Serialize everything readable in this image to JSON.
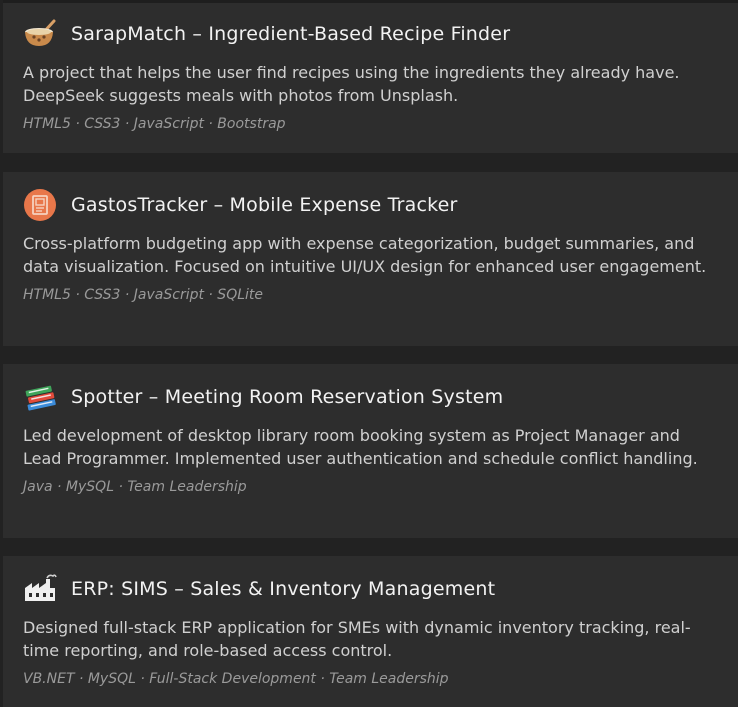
{
  "projects": [
    {
      "icon": "mixing-bowl-icon",
      "title": "SarapMatch – Ingredient-Based Recipe Finder",
      "description": "A project that helps the user find recipes using the ingredients they already have. DeepSeek suggests meals with photos from Unsplash.",
      "tags": "HTML5 · CSS3 · JavaScript · Bootstrap"
    },
    {
      "icon": "receipt-app-icon",
      "title": "GastosTracker – Mobile Expense Tracker",
      "description": "Cross-platform budgeting app with expense categorization, budget summaries, and data visualization. Focused on intuitive UI/UX design for enhanced user engagement.",
      "tags": "HTML5 · CSS3 · JavaScript · SQLite"
    },
    {
      "icon": "books-icon",
      "title": "Spotter – Meeting Room Reservation System",
      "description": "Led development of desktop library room booking system as Project Manager and Lead Programmer. Implemented user authentication and schedule conflict handling.",
      "tags": "Java · MySQL · Team Leadership"
    },
    {
      "icon": "factory-icon",
      "title": "ERP: SIMS – Sales & Inventory Management",
      "description": "Designed full-stack ERP application for SMEs with dynamic inventory tracking, real-time reporting, and role-based access control.",
      "tags": "VB.NET · MySQL · Full-Stack Development · Team Leadership"
    }
  ],
  "colors": {
    "page_background": "#222222",
    "card_background": "#2d2d2d",
    "title_text": "#f2f2f2",
    "description_text": "#d0d0d0",
    "tag_text": "#9a9a9a",
    "receipt_icon_orange": "#e8774a"
  }
}
